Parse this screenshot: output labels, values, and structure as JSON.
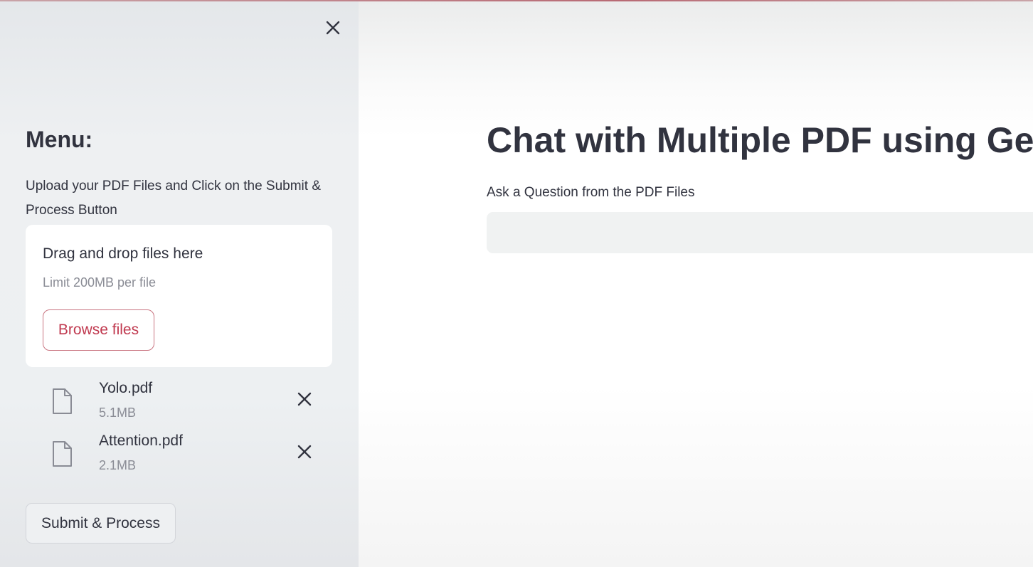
{
  "sidebar": {
    "menu_title": "Menu:",
    "instructions": "Upload your PDF Files and Click on the Submit & Process Button",
    "uploader": {
      "drop_title": "Drag and drop files here",
      "limit": "Limit 200MB per file",
      "browse_label": "Browse files"
    },
    "files": [
      {
        "name": "Yolo.pdf",
        "size": "5.1MB",
        "icon": "file-icon"
      },
      {
        "name": "Attention.pdf",
        "size": "2.1MB",
        "icon": "file-icon"
      }
    ],
    "submit_label": "Submit & Process"
  },
  "main": {
    "title": "Chat with Multiple PDF using Gem",
    "question_label": "Ask a Question from the PDF Files",
    "question_value": ""
  },
  "icons": {
    "close": "close-icon",
    "file": "file-icon",
    "remove": "close-icon"
  },
  "colors": {
    "accent": "#c0394f",
    "sidebar_bg": "#eef0f2",
    "text": "#31333f",
    "muted": "#8a8c95"
  }
}
